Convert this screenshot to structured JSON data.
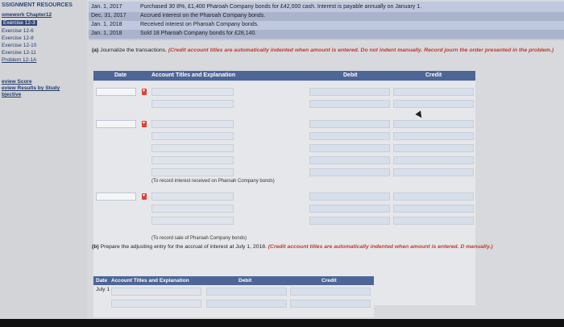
{
  "sidebar": {
    "header": "SSIGNMENT RESOURCES",
    "items": [
      {
        "label": "omework Chapter12",
        "style": "bold u"
      },
      {
        "label": "Exercise 12-3",
        "style": "active"
      },
      {
        "label": "Exercise 12-6",
        "style": ""
      },
      {
        "label": "Exercise 12-8",
        "style": ""
      },
      {
        "label": "Exercise 12-10",
        "style": ""
      },
      {
        "label": "Exercise 12-11",
        "style": ""
      },
      {
        "label": "Problem 12-1A",
        "style": ""
      }
    ],
    "links": [
      "eview Score",
      "eview Results by Study",
      "bjective"
    ]
  },
  "events": [
    {
      "date": "Jan.  1, 2017",
      "desc": "Purchased 30 8%, £1,400 Pharoah Company bonds for £42,000 cash. Interest is payable annually on January 1."
    },
    {
      "date": "Dec. 31, 2017",
      "desc": "Accrued interest on the Pharoah Company bonds."
    },
    {
      "date": "Jan.  1, 2018",
      "desc": "Received interest on Pharoah Company bonds."
    },
    {
      "date": "Jan.  1, 2018",
      "desc": "Sold 18 Pharoah Company bonds for £28,140."
    }
  ],
  "part_a": {
    "lead": "(a)",
    "text": " Journalize the transactions. ",
    "note": "(Credit account titles are automatically indented when amount is entered. Do not indent manually. Record journ the order presented in the problem.)"
  },
  "table": {
    "headers": {
      "date": "Date",
      "account": "Account Titles and Explanation",
      "debit": "Debit",
      "credit": "Credit"
    },
    "memo1": "(To record interest received on Pharoah Company bonds)",
    "memo2": "(To record sale of Pharoah Company bonds)"
  },
  "part_b": {
    "lead": "(b)",
    "text": " Prepare the adjusting entry for the accrual of interest at July 1, 2018. ",
    "note": "(Credit account titles are automatically indented when amount is entered. D manually.)"
  },
  "table2": {
    "headers": {
      "date": "Date",
      "account": "Account Titles and Explanation",
      "debit": "Debit",
      "credit": "Credit"
    },
    "date_value": "July 1"
  },
  "colors": {
    "accent": "#4e6597",
    "note": "#c0392b",
    "sidebar_link": "#243a6a"
  }
}
